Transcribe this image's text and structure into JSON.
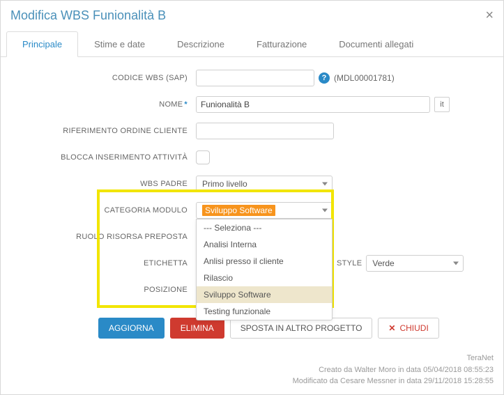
{
  "title": "Modifica WBS Funionalità B",
  "tabs": [
    {
      "label": "Principale",
      "active": true
    },
    {
      "label": "Stime e date",
      "active": false
    },
    {
      "label": "Descrizione",
      "active": false
    },
    {
      "label": "Fatturazione",
      "active": false
    },
    {
      "label": "Documenti allegati",
      "active": false
    }
  ],
  "labels": {
    "codice": "CODICE WBS (SAP)",
    "nome": "NOME",
    "riferimento": "RIFERIMENTO ORDINE CLIENTE",
    "blocca": "BLOCCA INSERIMENTO ATTIVITÀ",
    "padre": "WBS PADRE",
    "categoria": "CATEGORIA MODULO",
    "ruolo": "RUOLO RISORSA PREPOSTA",
    "etichetta": "ETICHETTA",
    "posizione": "POSIZIONE",
    "style": "STYLE"
  },
  "values": {
    "codice": "",
    "codice_ext": "(MDL00001781)",
    "nome": "Funionalità B",
    "lang": "it",
    "riferimento": "",
    "padre": "Primo livello",
    "categoria": "Sviluppo Software",
    "style": "Verde"
  },
  "categoria_options": [
    "--- Seleziona ---",
    "Analisi Interna",
    "Anlisi presso il cliente",
    "Rilascio",
    "Sviluppo Software",
    "Testing funzionale"
  ],
  "categoria_hover_index": 4,
  "buttons": {
    "aggiorna": "AGGIORNA",
    "elimina": "ELIMINA",
    "sposta": "SPOSTA IN ALTRO PROGETTO",
    "chiudi": "CHIUDI"
  },
  "footer": {
    "brand": "TeraNet",
    "created": "Creato da Walter Moro in data 05/04/2018 08:55:23",
    "modified": "Modificato da Cesare Messner in data 29/11/2018 15:28:55"
  }
}
